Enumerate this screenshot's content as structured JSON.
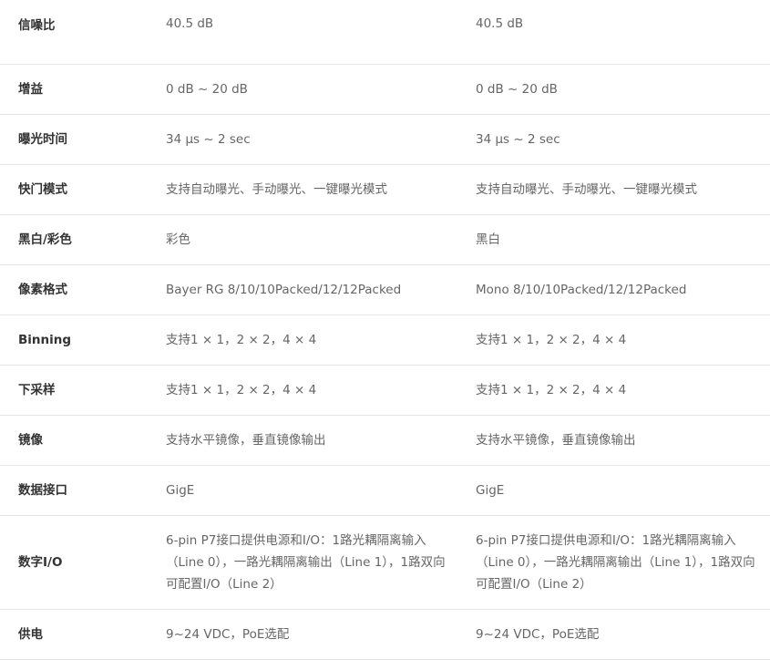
{
  "rows": [
    {
      "label": "信噪比",
      "a": "40.5 dB",
      "b": "40.5 dB"
    },
    {
      "label": "增益",
      "a": "0 dB ~ 20 dB",
      "b": "0 dB ~ 20 dB"
    },
    {
      "label": "曝光时间",
      "a": "34 μs ~ 2 sec",
      "b": "34 μs ~ 2 sec"
    },
    {
      "label": "快门模式",
      "a": "支持自动曝光、手动曝光、一键曝光模式",
      "b": "支持自动曝光、手动曝光、一键曝光模式"
    },
    {
      "label": "黑白/彩色",
      "a": "彩色",
      "b": "黑白"
    },
    {
      "label": "像素格式",
      "a": "Bayer RG 8/10/10Packed/12/12Packed",
      "b": "Mono 8/10/10Packed/12/12Packed"
    },
    {
      "label": "Binning",
      "a": "支持1 × 1，2 × 2，4 × 4",
      "b": "支持1 × 1，2 × 2，4 × 4"
    },
    {
      "label": "下采样",
      "a": "支持1 × 1，2 × 2，4 × 4",
      "b": "支持1 × 1，2 × 2，4 × 4"
    },
    {
      "label": "镜像",
      "a": "支持水平镜像，垂直镜像输出",
      "b": "支持水平镜像，垂直镜像输出"
    },
    {
      "label": "数据接口",
      "a": "GigE",
      "b": "GigE"
    },
    {
      "label": "数字I/O",
      "a": "6-pin P7接口提供电源和I/O：1路光耦隔离输入（Line 0），一路光耦隔离输出（Line 1），1路双向可配置I/O（Line 2）",
      "b": "6-pin P7接口提供电源和I/O：1路光耦隔离输入（Line 0），一路光耦隔离输出（Line 1），1路双向可配置I/O（Line 2）"
    },
    {
      "label": "供电",
      "a": "9~24 VDC，PoE选配",
      "b": "9~24 VDC，PoE选配"
    }
  ]
}
